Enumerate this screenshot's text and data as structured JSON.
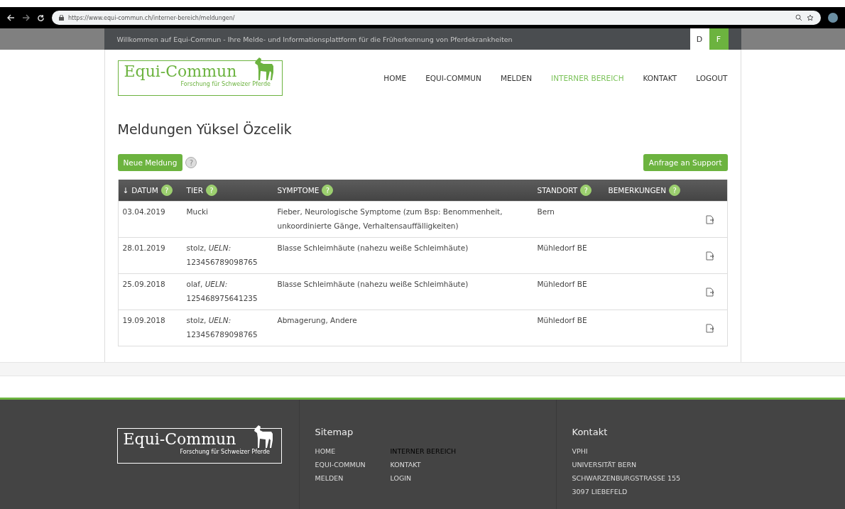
{
  "browser": {
    "url": "https://www.equi-commun.ch/interner-bereich/meldungen/"
  },
  "topbar": {
    "welcome": "Willkommen auf Equi-Commun - Ihre Melde- und Informationsplattform für die Früherkennung von Pferdekrankheiten",
    "languages": [
      {
        "label": "D",
        "selected": false
      },
      {
        "label": "F",
        "selected": true
      }
    ]
  },
  "logo": {
    "title": "Equi-Commun",
    "subtitle": "Forschung für Schweizer Pferde"
  },
  "nav": [
    {
      "label": "HOME",
      "selected": false
    },
    {
      "label": "EQUI-COMMUN",
      "selected": false
    },
    {
      "label": "MELDEN",
      "selected": false
    },
    {
      "label": "INTERNER BEREICH",
      "selected": true
    },
    {
      "label": "KONTAKT",
      "selected": false
    },
    {
      "label": "LOGOUT",
      "selected": false
    }
  ],
  "heading": "Meldungen Yüksel Özcelik",
  "actions": {
    "new": "Neue Meldung",
    "help": "?",
    "support": "Anfrage an Support"
  },
  "table": {
    "columns": [
      {
        "label": "DATUM",
        "sort": "↓",
        "help": "?"
      },
      {
        "label": "TIER",
        "help": "?"
      },
      {
        "label": "SYMPTOME",
        "help": "?"
      },
      {
        "label": "STANDORT",
        "help": "?"
      },
      {
        "label": "BEMERKUNGEN",
        "help": "?"
      }
    ],
    "rows": [
      {
        "datum": "03.04.2019",
        "tier": "Mucki",
        "symptome": "Fieber, Neurologische Symptome (zum Bsp: Benommenheit, unkoordinierte Gänge, Verhaltensauffälligkeiten)",
        "standort": "Bern"
      },
      {
        "datum": "28.01.2019",
        "tier": "stolz, *UELN:* 123456789098765",
        "symptome": "Blasse Schleimhäute (nahezu weiße Schleimhäute)",
        "standort": "Mühledorf BE"
      },
      {
        "datum": "25.09.2018",
        "tier": "olaf, *UELN:* 125468975641235",
        "symptome": "Blasse Schleimhäute (nahezu weiße Schleimhäute)",
        "standort": "Mühledorf BE"
      },
      {
        "datum": "19.09.2018",
        "tier": "stolz, *UELN:* 123456789098765",
        "symptome": "Abmagerung, Andere",
        "standort": "Mühledorf BE"
      }
    ]
  },
  "footer": {
    "logo": {
      "title": "Equi-Commun",
      "subtitle": "Forschung für Schweizer Pferde"
    },
    "sitemap": {
      "title": "Sitemap",
      "links": [
        {
          "label": "HOME",
          "selected": false
        },
        {
          "label": "INTERNER BEREICH",
          "selected": true
        },
        {
          "label": "EQUI-COMMUN",
          "selected": false
        },
        {
          "label": "KONTAKT",
          "selected": false
        },
        {
          "label": "MELDEN",
          "selected": false
        },
        {
          "label": "LOGIN",
          "selected": false
        }
      ]
    },
    "contact": {
      "title": "Kontakt",
      "lines": [
        "VPHI",
        "UNIVERSITÄT BERN",
        "SCHWARZENBURGSTRASSE 155",
        "3097 LIEBEFELD"
      ]
    }
  }
}
